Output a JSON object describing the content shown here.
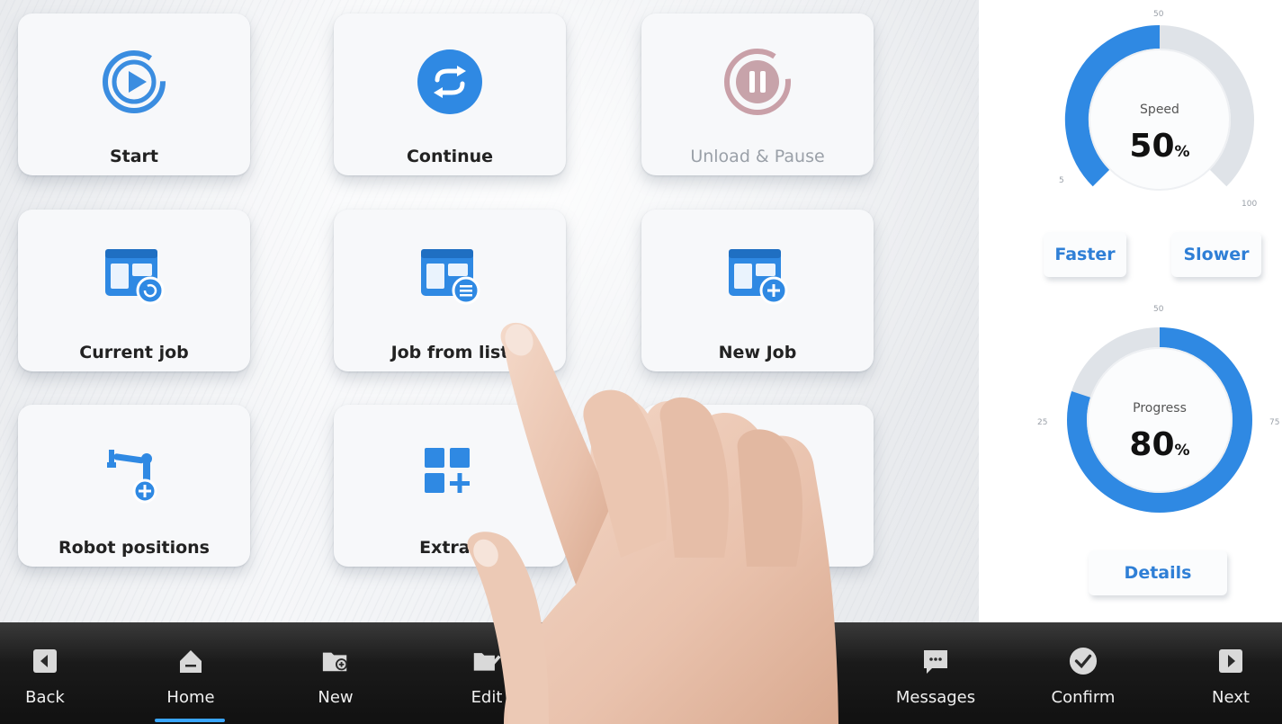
{
  "tiles": [
    {
      "label": "Start",
      "icon": "play-circle-icon"
    },
    {
      "label": "Continue",
      "icon": "refresh-circle-icon"
    },
    {
      "label": "Unload & Pause",
      "icon": "pause-circle-icon"
    },
    {
      "label": "Current job",
      "icon": "job-current-icon"
    },
    {
      "label": "Job from list",
      "icon": "job-list-icon"
    },
    {
      "label": "New Job",
      "icon": "job-new-icon"
    },
    {
      "label": "Robot positions",
      "icon": "robot-arm-add-icon"
    },
    {
      "label": "Extras",
      "icon": "grid-add-icon"
    },
    {
      "label": "",
      "icon": "card-icon"
    }
  ],
  "speed": {
    "title": "Speed",
    "value": "50",
    "unit": "%",
    "fraction": 0.5,
    "tick_top": "50",
    "tick_left": "5",
    "tick_right": "100"
  },
  "speed_buttons": {
    "faster": "Faster",
    "slower": "Slower"
  },
  "progress": {
    "title": "Progress",
    "value": "80",
    "unit": "%",
    "fraction": 0.8,
    "tick_top": "50",
    "tick_left": "25",
    "tick_right": "75"
  },
  "details_button": "Details",
  "colors": {
    "accent": "#2f7fd6",
    "track": "#dfe3e8",
    "bar": "#151515"
  },
  "bottom_nav": [
    {
      "label": "Back",
      "icon": "back-arrow-icon"
    },
    {
      "label": "Home",
      "icon": "home-icon"
    },
    {
      "label": "New",
      "icon": "new-folder-icon"
    },
    {
      "label": "Edit",
      "icon": "edit-folder-icon"
    },
    {
      "label": "Messages",
      "icon": "message-icon"
    },
    {
      "label": "Confirm",
      "icon": "check-circle-icon"
    },
    {
      "label": "Next",
      "icon": "next-arrow-icon"
    }
  ]
}
